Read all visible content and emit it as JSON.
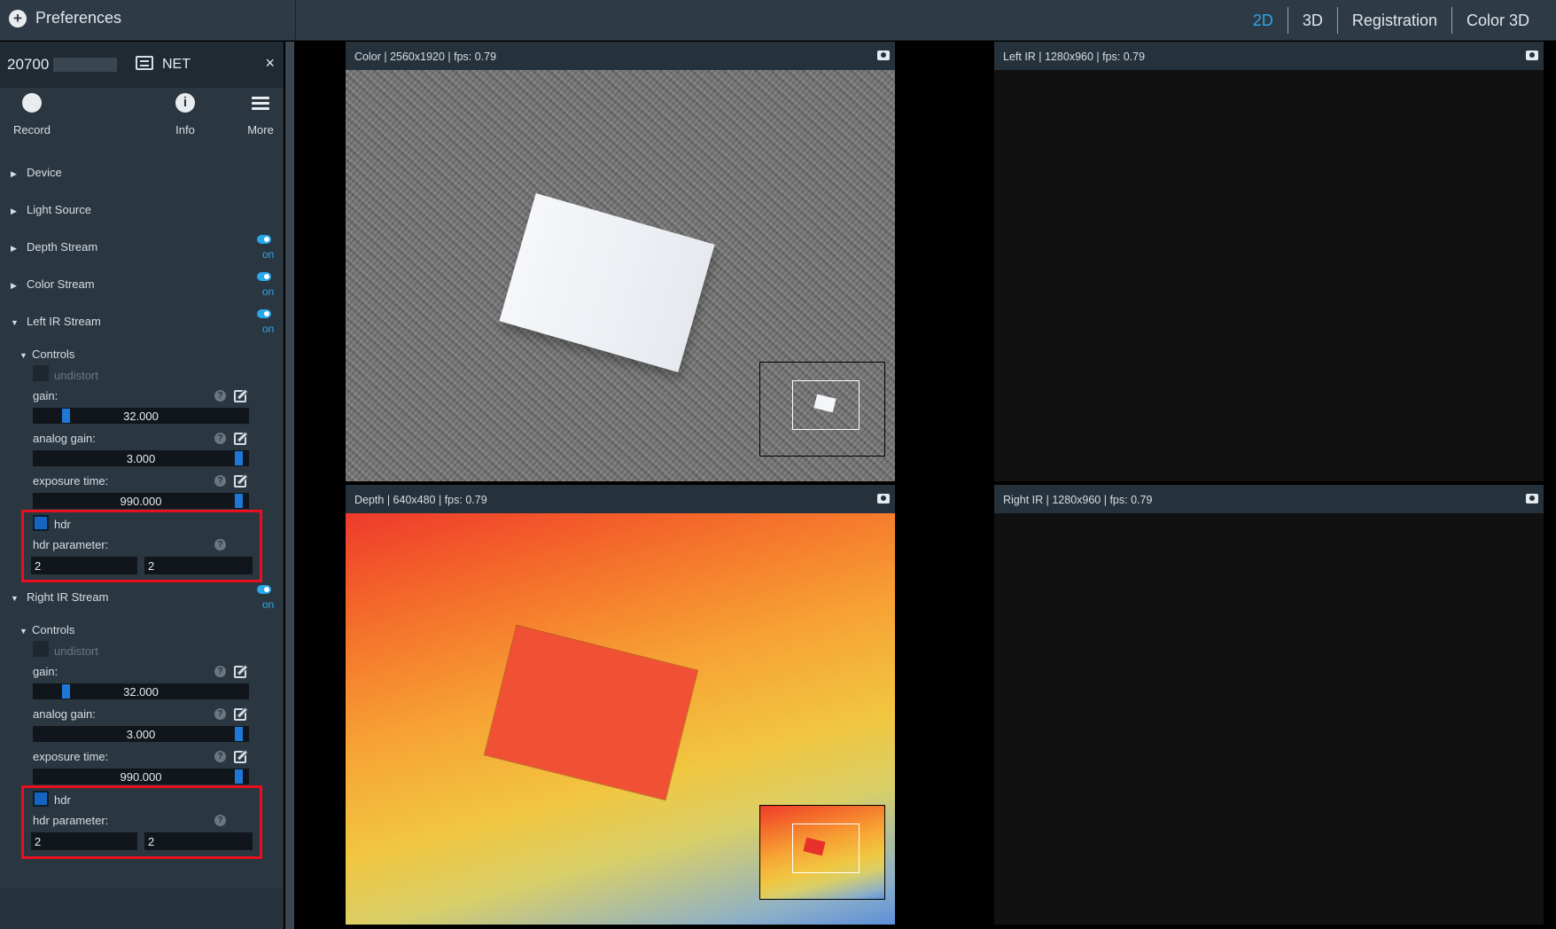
{
  "topbar": {
    "preferences_label": "Preferences",
    "modes": [
      "2D",
      "3D",
      "Registration",
      "Color 3D"
    ],
    "active_mode": "2D"
  },
  "device": {
    "serial": "20700",
    "connection": "NET",
    "close_glyph": "×",
    "toolbar": {
      "record": "Record",
      "info": "Info",
      "more": "More"
    }
  },
  "sections": {
    "device": "Device",
    "light_source": "Light Source",
    "depth_stream": "Depth Stream",
    "color_stream": "Color Stream",
    "left_ir": "Left IR Stream",
    "right_ir": "Right IR Stream",
    "on_label": "on"
  },
  "left_ir": {
    "controls": "Controls",
    "undistort": "undistort",
    "gain_label": "gain:",
    "gain_value": "32.000",
    "gain_fraction": 0.14,
    "analog_gain_label": "analog gain:",
    "analog_gain_value": "3.000",
    "analog_gain_fraction": 0.97,
    "exposure_label": "exposure time:",
    "exposure_value": "990.000",
    "exposure_fraction": 0.97,
    "hdr_label": "hdr",
    "hdr_param_label": "hdr parameter:",
    "hdr_param_1": "2",
    "hdr_param_2": "2"
  },
  "right_ir": {
    "controls": "Controls",
    "undistort": "undistort",
    "gain_label": "gain:",
    "gain_value": "32.000",
    "gain_fraction": 0.14,
    "analog_gain_label": "analog gain:",
    "analog_gain_value": "3.000",
    "analog_gain_fraction": 0.97,
    "exposure_label": "exposure time:",
    "exposure_value": "990.000",
    "exposure_fraction": 0.97,
    "hdr_label": "hdr",
    "hdr_param_label": "hdr parameter:",
    "hdr_param_1": "2",
    "hdr_param_2": "2"
  },
  "views": {
    "color": "Color | 2560x1920 | fps: 0.79",
    "depth": "Depth | 640x480 | fps: 0.79",
    "left_ir": "Left IR | 1280x960 | fps: 0.79",
    "right_ir": "Right IR | 1280x960 | fps: 0.79"
  },
  "icons": {
    "plus": "plus-circle-icon",
    "net": "ethernet-icon",
    "record": "record-icon",
    "info": "info-icon",
    "more": "menu-icon",
    "help": "help-icon",
    "edit": "edit-icon",
    "camera": "camera-icon"
  },
  "colors": {
    "accent": "#2aa7e8",
    "highlight_box": "#e8101e",
    "slider_fill": "#1e78d8"
  }
}
